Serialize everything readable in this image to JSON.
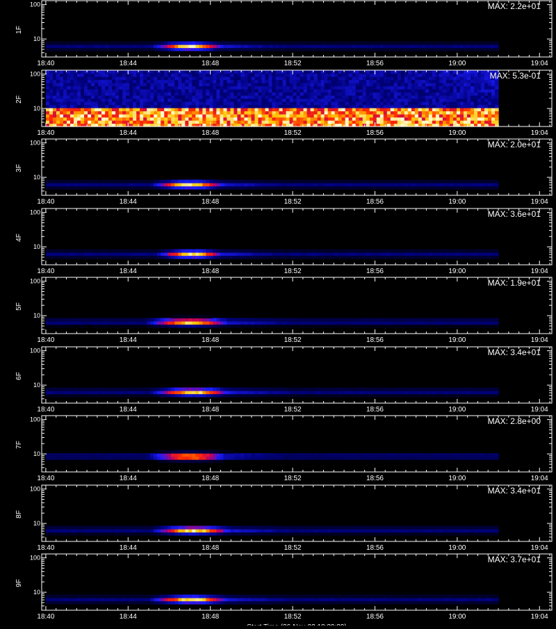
{
  "chart_data": {
    "type": "heatmap",
    "x_tick_labels": [
      "18:40",
      "18:44",
      "18:48",
      "18:52",
      "18:56",
      "19:00",
      "19:04"
    ],
    "x_ticks_minutes": [
      0,
      4,
      8,
      12,
      16,
      20,
      24
    ],
    "x_range_minutes": [
      -0.2,
      24.6
    ],
    "data_end_minute": 22.0,
    "y_tick_labels": [
      "100",
      "10"
    ],
    "y_scale": "log",
    "y_range": [
      3,
      130
    ],
    "colormap": [
      "#000000",
      "#00007a",
      "#1c1cff",
      "#c00060",
      "#ff2a00",
      "#ffc400",
      "#ffffe0"
    ],
    "panels": [
      {
        "label": "1F",
        "max": "MAX: 2.2e+01",
        "kind": "burst",
        "peak_minute": 7.0,
        "peak_y": 6.2,
        "duration": 3.2
      },
      {
        "label": "2F",
        "max": "MAX: 5.3e-01",
        "kind": "noisy"
      },
      {
        "label": "3F",
        "max": "MAX: 2.0e+01",
        "kind": "burst",
        "peak_minute": 7.0,
        "peak_y": 6.2,
        "duration": 3.3
      },
      {
        "label": "4F",
        "max": "MAX: 3.6e+01",
        "kind": "burst",
        "peak_minute": 7.1,
        "peak_y": 6.2,
        "duration": 3.0
      },
      {
        "label": "5F",
        "max": "MAX: 1.9e+01",
        "kind": "burst",
        "peak_minute": 7.0,
        "peak_y": 6.6,
        "duration": 3.8
      },
      {
        "label": "6F",
        "max": "MAX: 3.4e+01",
        "kind": "burst",
        "peak_minute": 7.2,
        "peak_y": 6.4,
        "duration": 3.6
      },
      {
        "label": "7F",
        "max": "MAX: 2.8e+00",
        "kind": "burst",
        "peak_minute": 7.0,
        "peak_y": 8.6,
        "duration": 3.6
      },
      {
        "label": "8F",
        "max": "MAX: 3.4e+01",
        "kind": "burst",
        "peak_minute": 7.2,
        "peak_y": 6.4,
        "duration": 3.6
      },
      {
        "label": "9F",
        "max": "MAX: 3.7e+01",
        "kind": "burst",
        "peak_minute": 7.1,
        "peak_y": 6.2,
        "duration": 3.6
      }
    ],
    "bottom_caption": "Start Time (26-Nov-22 18:39:39)"
  }
}
